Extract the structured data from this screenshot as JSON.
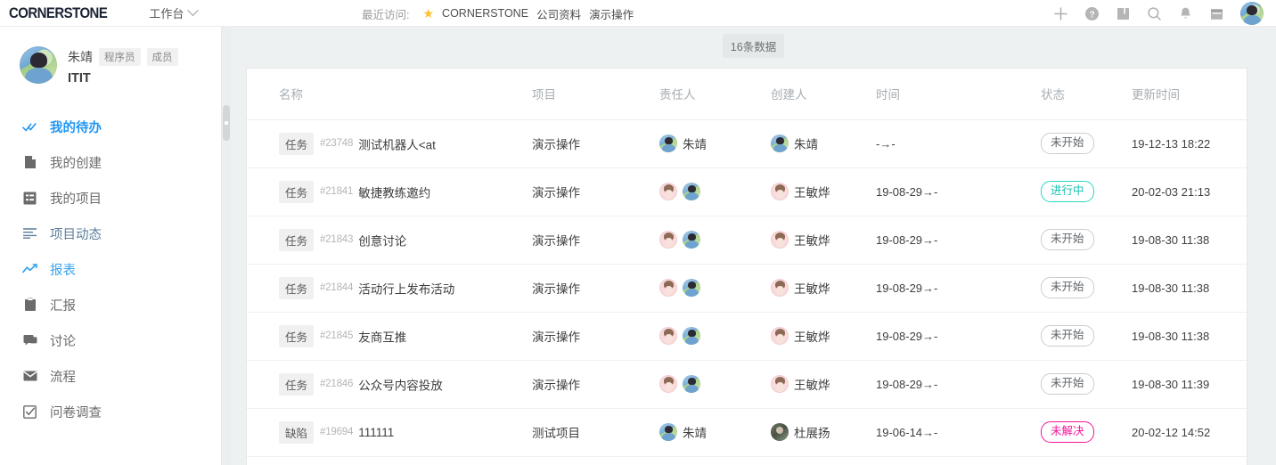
{
  "topbar": {
    "brand": "CORNERSTONE",
    "workspace": "工作台",
    "recent_label": "最近访问:",
    "recent_links": [
      "CORNERSTONE",
      "公司资料",
      "演示操作"
    ],
    "icons": [
      "plus-icon",
      "help-icon",
      "book-icon",
      "search-icon",
      "bell-icon",
      "calendar-icon",
      "user-avatar"
    ]
  },
  "sidebar": {
    "user": {
      "name": "朱靖",
      "tags": [
        "程序员",
        "成员"
      ],
      "team": "ITIT"
    },
    "items": [
      {
        "label": "我的待办",
        "icon": "double-check-icon",
        "style": "blue"
      },
      {
        "label": "我的创建",
        "icon": "file-icon",
        "style": "gray"
      },
      {
        "label": "我的项目",
        "icon": "list-box-icon",
        "style": "gray"
      },
      {
        "label": "项目动态",
        "icon": "lines-icon",
        "style": "slate"
      },
      {
        "label": "报表",
        "icon": "trend-line-icon",
        "style": "sky"
      },
      {
        "label": "汇报",
        "icon": "clipboard-icon",
        "style": "gray"
      },
      {
        "label": "讨论",
        "icon": "chat-icon",
        "style": "gray"
      },
      {
        "label": "流程",
        "icon": "envelope-icon",
        "style": "gray"
      },
      {
        "label": "问卷调查",
        "icon": "checkbox-icon",
        "style": "gray"
      }
    ]
  },
  "main": {
    "count_badge": "16条数据",
    "columns": [
      "名称",
      "项目",
      "责任人",
      "创建人",
      "时间",
      "状态",
      "更新时间"
    ],
    "rows": [
      {
        "type": "任务",
        "id": "#23748",
        "title": "测试机器人<at",
        "project": "演示操作",
        "owners": [
          {
            "avatar": "blue",
            "name": "朱靖"
          }
        ],
        "creator": {
          "avatar": "blue",
          "name": "朱靖"
        },
        "time": "-→-",
        "status": "未开始",
        "status_style": "default",
        "updated": "19-12-13 18:22"
      },
      {
        "type": "任务",
        "id": "#21841",
        "title": "敏捷教练邀约",
        "project": "演示操作",
        "owners": [
          {
            "avatar": "pink",
            "name": ""
          },
          {
            "avatar": "blue",
            "name": ""
          }
        ],
        "creator": {
          "avatar": "pink",
          "name": "王敏烨"
        },
        "time": "19-08-29→-",
        "status": "进行中",
        "status_style": "progress",
        "updated": "20-02-03 21:13"
      },
      {
        "type": "任务",
        "id": "#21843",
        "title": "创意讨论",
        "project": "演示操作",
        "owners": [
          {
            "avatar": "pink",
            "name": ""
          },
          {
            "avatar": "blue",
            "name": ""
          }
        ],
        "creator": {
          "avatar": "pink",
          "name": "王敏烨"
        },
        "time": "19-08-29→-",
        "status": "未开始",
        "status_style": "default",
        "updated": "19-08-30 11:38"
      },
      {
        "type": "任务",
        "id": "#21844",
        "title": "活动行上发布活动",
        "project": "演示操作",
        "owners": [
          {
            "avatar": "pink",
            "name": ""
          },
          {
            "avatar": "blue",
            "name": ""
          }
        ],
        "creator": {
          "avatar": "pink",
          "name": "王敏烨"
        },
        "time": "19-08-29→-",
        "status": "未开始",
        "status_style": "default",
        "updated": "19-08-30 11:38"
      },
      {
        "type": "任务",
        "id": "#21845",
        "title": "友商互推",
        "project": "演示操作",
        "owners": [
          {
            "avatar": "pink",
            "name": ""
          },
          {
            "avatar": "blue",
            "name": ""
          }
        ],
        "creator": {
          "avatar": "pink",
          "name": "王敏烨"
        },
        "time": "19-08-29→-",
        "status": "未开始",
        "status_style": "default",
        "updated": "19-08-30 11:38"
      },
      {
        "type": "任务",
        "id": "#21846",
        "title": "公众号内容投放",
        "project": "演示操作",
        "owners": [
          {
            "avatar": "pink",
            "name": ""
          },
          {
            "avatar": "blue",
            "name": ""
          }
        ],
        "creator": {
          "avatar": "pink",
          "name": "王敏烨"
        },
        "time": "19-08-29→-",
        "status": "未开始",
        "status_style": "default",
        "updated": "19-08-30 11:39"
      },
      {
        "type": "缺陷",
        "id": "#19694",
        "title": "111111",
        "project": "测试项目",
        "owners": [
          {
            "avatar": "blue",
            "name": "朱靖"
          }
        ],
        "creator": {
          "avatar": "dark",
          "name": "杜展扬"
        },
        "time": "19-06-14→-",
        "status": "未解决",
        "status_style": "unresolved",
        "updated": "20-02-12 14:52"
      }
    ]
  },
  "colors": {
    "accent": "#2196f3",
    "progress": "#17c3b2",
    "unresolved": "#f5169b",
    "content_bg": "#eef1f2"
  }
}
